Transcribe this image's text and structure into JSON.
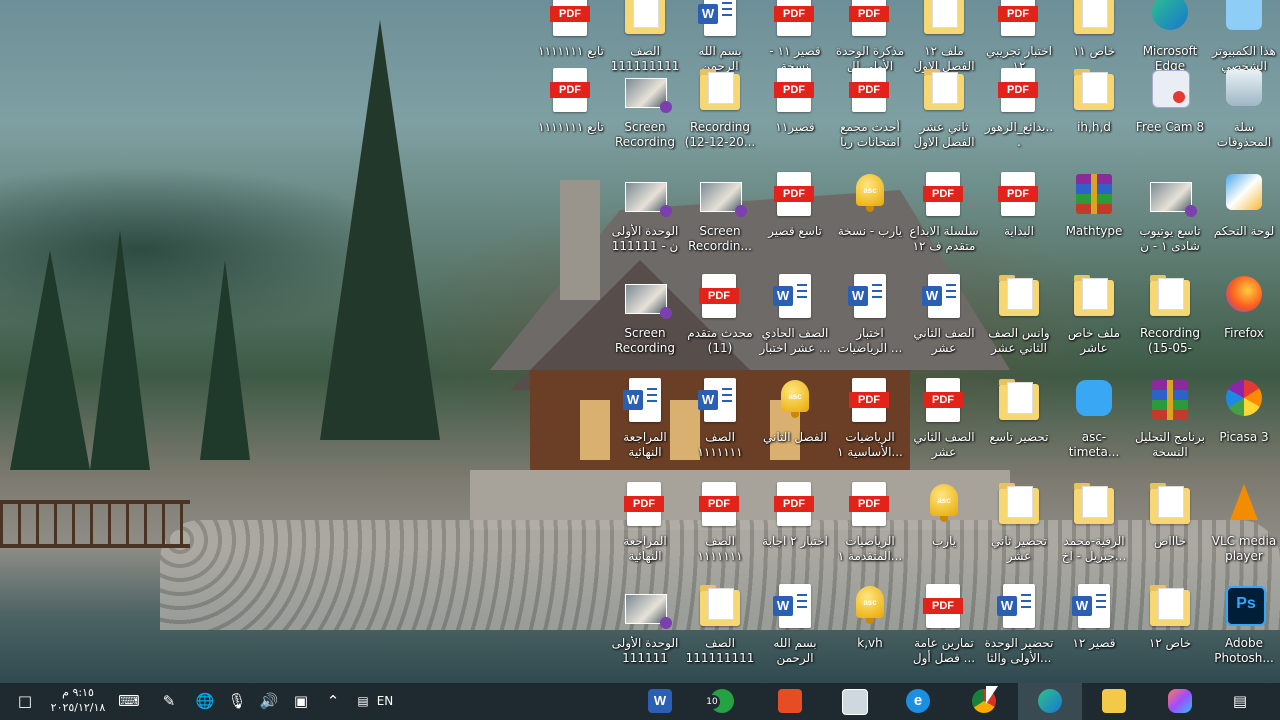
{
  "icons": [
    {
      "id": "c1r0",
      "label": "هذا الكمبيوتر الشخصي",
      "type": "pc"
    },
    {
      "id": "c1r1",
      "label": "سلة المحذوفات",
      "type": "recycle"
    },
    {
      "id": "c1r2",
      "label": "لوحة التحكم",
      "type": "control"
    },
    {
      "id": "c1r3",
      "label": "Firefox",
      "type": "firefox"
    },
    {
      "id": "c1r4",
      "label": "Picasa 3",
      "type": "picasa"
    },
    {
      "id": "c1r5",
      "label": "VLC media player",
      "type": "vlc"
    },
    {
      "id": "c1r6",
      "label": "Adobe Photosh...",
      "type": "ps"
    },
    {
      "id": "c2r0",
      "label": "Microsoft Edge",
      "type": "edge"
    },
    {
      "id": "c2r1",
      "label": "Free Cam 8",
      "type": "freecam"
    },
    {
      "id": "c2r2",
      "label": "تاسع يوتيوب شادى ١ - ن",
      "type": "video"
    },
    {
      "id": "c2r3",
      "label": "Recording (15-05-202...",
      "type": "folder"
    },
    {
      "id": "c2r4",
      "label": "برنامج التحليل النسخة الأخيرة",
      "type": "rar"
    },
    {
      "id": "c2r5",
      "label": "خاااص",
      "type": "folder"
    },
    {
      "id": "c2r6",
      "label": "خاص ١٢",
      "type": "folder"
    },
    {
      "id": "c3r0",
      "label": "خاص ١١",
      "type": "folder"
    },
    {
      "id": "c3r1",
      "label": "ih,h,d",
      "type": "folder"
    },
    {
      "id": "c3r2",
      "label": "Mathtype",
      "type": "rar"
    },
    {
      "id": "c3r3",
      "label": "ملف خاص عاشر",
      "type": "folder"
    },
    {
      "id": "c3r4",
      "label": "asc-timeta...",
      "type": "asc"
    },
    {
      "id": "c3r5",
      "label": "الرقية-محمد جبريل - اخ...",
      "type": "folder"
    },
    {
      "id": "c3r6",
      "label": "قصير ١٢",
      "type": "word"
    },
    {
      "id": "c4r0",
      "label": "اختبار تجريبي ١٢",
      "type": "pdf"
    },
    {
      "id": "c4r1",
      "label": "بدائع_الزهور...",
      "type": "pdf"
    },
    {
      "id": "c4r2",
      "label": "البداية",
      "type": "pdf"
    },
    {
      "id": "c4r3",
      "label": "وانس الصف الثاني عشر",
      "type": "folder"
    },
    {
      "id": "c4r4",
      "label": "تحضير تاسع",
      "type": "folder"
    },
    {
      "id": "c4r5",
      "label": "تحضير ثاني عشر",
      "type": "folder"
    },
    {
      "id": "c4r6",
      "label": "تحضير الوحدة الأولى والثا...",
      "type": "word"
    },
    {
      "id": "c5r0",
      "label": "ملف ١٢ الفصل الاول",
      "type": "folder"
    },
    {
      "id": "c5r1",
      "label": "ثاني عشر الفصل الاول",
      "type": "folder"
    },
    {
      "id": "c5r2",
      "label": "سلسلة الابداع متقدم ف ١٢",
      "type": "pdf"
    },
    {
      "id": "c5r3",
      "label": "الصف الثاني عشر",
      "type": "word"
    },
    {
      "id": "c5r4",
      "label": "الصف الثاني عشر",
      "type": "pdf"
    },
    {
      "id": "c5r5",
      "label": "يارب",
      "type": "bell"
    },
    {
      "id": "c5r6",
      "label": "تمارين عامة فصل أول ...",
      "type": "pdf"
    },
    {
      "id": "c6r0",
      "label": "مذكرة الوحدة الأولى لل",
      "type": "pdf"
    },
    {
      "id": "c6r1",
      "label": "أحدث مجمع امتحانات ريا ...",
      "type": "pdf"
    },
    {
      "id": "c6r2",
      "label": "يارب - نسخة",
      "type": "bell"
    },
    {
      "id": "c6r3",
      "label": "اختبار الرياضيات ...",
      "type": "word"
    },
    {
      "id": "c6r4",
      "label": "الرياضيات الأساسية ١...",
      "type": "pdf"
    },
    {
      "id": "c6r5",
      "label": "الرياضيات المتقدمة ١...",
      "type": "pdf"
    },
    {
      "id": "c6r6",
      "label": "k,vh",
      "type": "bell"
    },
    {
      "id": "c7r0",
      "label": "قصير ١١ - نسخة",
      "type": "pdf"
    },
    {
      "id": "c7r1",
      "label": "قصير١١",
      "type": "pdf"
    },
    {
      "id": "c7r2",
      "label": "تاسع قصير",
      "type": "pdf"
    },
    {
      "id": "c7r3",
      "label": "الصف الحادي عشر اختبار ...",
      "type": "word"
    },
    {
      "id": "c7r4",
      "label": "الفصل الثاني",
      "type": "bell"
    },
    {
      "id": "c7r5",
      "label": "اختبار ٢ اجابة",
      "type": "pdf"
    },
    {
      "id": "c7r6",
      "label": "بسم الله الرحمن الرحيم",
      "type": "word"
    },
    {
      "id": "c8r0",
      "label": "بسم الله الرحمن الرحيم",
      "type": "word"
    },
    {
      "id": "c8r1",
      "label": "Recording (12-12-20...",
      "type": "folder"
    },
    {
      "id": "c8r2",
      "label": "Screen Recordin...",
      "type": "video"
    },
    {
      "id": "c8r3",
      "label": "محدث متقدم (11)",
      "type": "pdf"
    },
    {
      "id": "c8r4",
      "label": "الصف ١١١١١١١",
      "type": "word"
    },
    {
      "id": "c8r5",
      "label": "الصف ١١١١١١١",
      "type": "pdf"
    },
    {
      "id": "c8r6",
      "label": "الصف 1111111111...",
      "type": "folder"
    },
    {
      "id": "c9r0",
      "label": "الصف 1111111111...",
      "type": "folder"
    },
    {
      "id": "c9r1",
      "label": "Screen Recording ...",
      "type": "video"
    },
    {
      "id": "c9r2",
      "label": "الوحدة الأولى ن - 111111",
      "type": "video"
    },
    {
      "id": "c9r3",
      "label": "Screen Recording ...",
      "type": "video"
    },
    {
      "id": "c9r4",
      "label": "المراجعة النهائية",
      "type": "word"
    },
    {
      "id": "c9r5",
      "label": "المراجعة النهائية",
      "type": "pdf"
    },
    {
      "id": "c9r6",
      "label": "الوحدة الأولى 111111",
      "type": "video"
    },
    {
      "id": "c10r0",
      "label": "تابع ١١١١١١١",
      "type": "pdf"
    },
    {
      "id": "c10r1",
      "label": "تابع ١١١١١١١",
      "type": "pdf"
    }
  ],
  "taskbar": {
    "clock_time": "٩:١٥ م",
    "clock_date": "٢٠٢٥/١٢/١٨",
    "language": "EN",
    "whatsapp_badge": "10"
  }
}
